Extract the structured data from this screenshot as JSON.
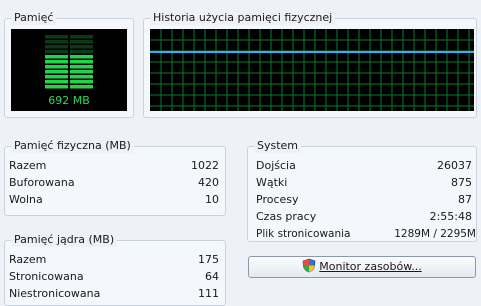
{
  "memory_gauge": {
    "title": "Pamięć",
    "value_label": "692 MB"
  },
  "history": {
    "title": "Historia użycia pamięci fizycznej",
    "usage_level_fraction": 0.72
  },
  "physical": {
    "title": "Pamięć fizyczna (MB)",
    "rows": [
      {
        "label": "Razem",
        "value": "1022"
      },
      {
        "label": "Buforowana",
        "value": "420"
      },
      {
        "label": "Wolna",
        "value": "10"
      }
    ]
  },
  "kernel": {
    "title": "Pamięć jądra (MB)",
    "rows": [
      {
        "label": "Razem",
        "value": "175"
      },
      {
        "label": "Stronicowana",
        "value": "64"
      },
      {
        "label": "Niestronicowana",
        "value": "111"
      }
    ]
  },
  "system": {
    "title": "System",
    "rows": [
      {
        "label": "Dojścia",
        "value": "26037"
      },
      {
        "label": "Wątki",
        "value": "875"
      },
      {
        "label": "Procesy",
        "value": "87"
      },
      {
        "label": "Czas pracy",
        "value": "2:55:48"
      },
      {
        "label": "Plik stronicowania",
        "value": "1289M / 2295M"
      }
    ]
  },
  "monitor_button": {
    "label": "Monitor zasobów...",
    "icon": "shield-icon"
  },
  "colors": {
    "graph_grid": "#0a7a2a",
    "graph_line": "#3aa8ff",
    "gauge_on": "#23d44a",
    "gauge_off": "#0b3a17"
  }
}
